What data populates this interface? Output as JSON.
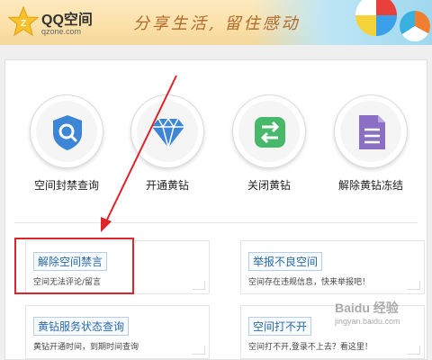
{
  "header": {
    "logo_title": "QQ空间",
    "logo_url": "qzone.com",
    "slogan": "分享生活, 留住感动"
  },
  "icons": [
    {
      "label": "空间封禁查询",
      "icon": "shield-search-icon"
    },
    {
      "label": "开通黄钻",
      "icon": "diamond-icon"
    },
    {
      "label": "关闭黄钻",
      "icon": "swap-arrows-icon"
    },
    {
      "label": "解除黄钻冻结",
      "icon": "document-icon"
    }
  ],
  "cards": [
    {
      "title": "解除空间禁言",
      "desc": "空间无法评论/留言"
    },
    {
      "title": "举报不良空间",
      "desc": "空间存在违规信息，快来举报吧！"
    },
    {
      "title": "黄钻服务状态查询",
      "desc": "黄钻开通时间，到期时间查询"
    },
    {
      "title": "空间打不开",
      "desc": "空间打不开,登录不上去？看这里！"
    }
  ],
  "watermark": {
    "brand": "Baidu 经验",
    "url": "jingyan.baidu.com"
  },
  "colors": {
    "accent_blue": "#2b6aa8",
    "highlight_red": "#e0232b",
    "icon_blue": "#3d86d6",
    "icon_green": "#48b86a",
    "icon_purple": "#8a6fc4"
  }
}
